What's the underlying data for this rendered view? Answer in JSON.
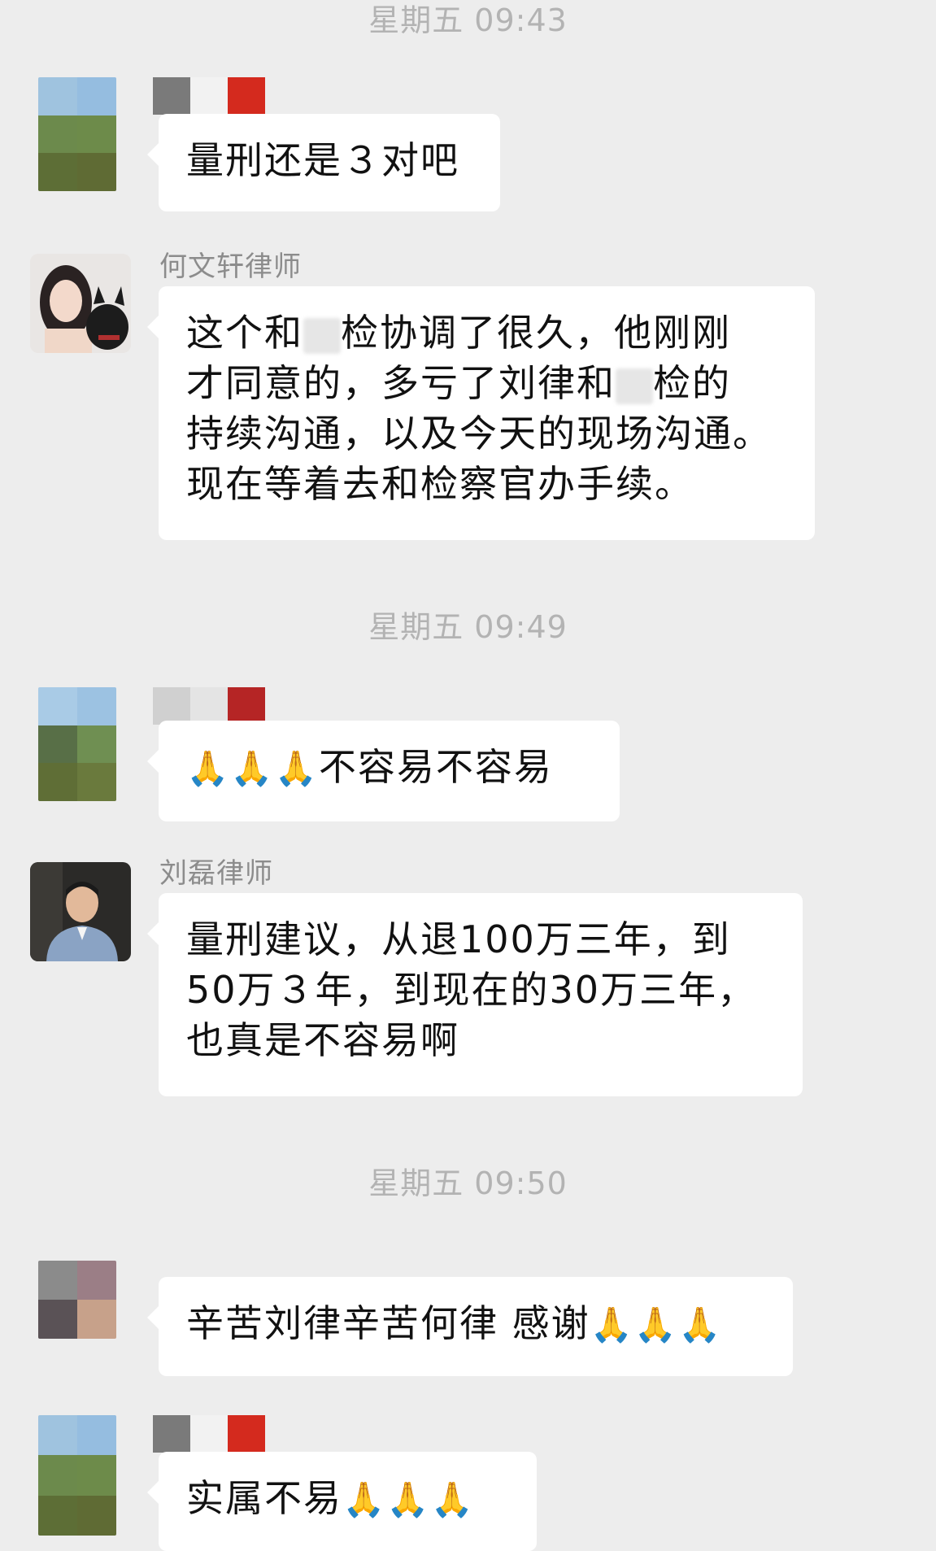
{
  "timestamps": [
    "星期五 09:43",
    "星期五 09:49",
    "星期五 09:50"
  ],
  "messages": [
    {
      "sender": "",
      "text": "量刑还是３对吧"
    },
    {
      "sender": "何文轩律师",
      "lines": [
        "这个和",
        "检协调了很久，他刚刚",
        "才同意的，多亏了刘律和",
        "检的",
        "持续沟通，以及今天的现场沟通。",
        "现在等着去和检察官办手续。"
      ]
    },
    {
      "sender": "",
      "emoji": "🙏🙏🙏",
      "text": "不容易不容易"
    },
    {
      "sender": "刘磊律师",
      "lines": [
        "量刑建议，从退100万三年，到",
        "50万３年，到现在的30万三年，",
        "也真是不容易啊"
      ]
    },
    {
      "sender": "",
      "text": "辛苦刘律辛苦何律 感谢",
      "emoji": "🙏🙏🙏"
    },
    {
      "sender": "",
      "text": "实属不易",
      "emoji": "🙏🙏🙏"
    }
  ],
  "colors": {
    "background": "#ededed",
    "bubble": "#ffffff",
    "timestamp": "#b3b3b3",
    "sender": "#8c8c8c"
  },
  "icons": {
    "avatar_placeholder": "pixelated-avatar",
    "lawyer_he_avatar": "woman-with-dog-avatar",
    "lawyer_liu_avatar": "man-portrait-avatar"
  }
}
